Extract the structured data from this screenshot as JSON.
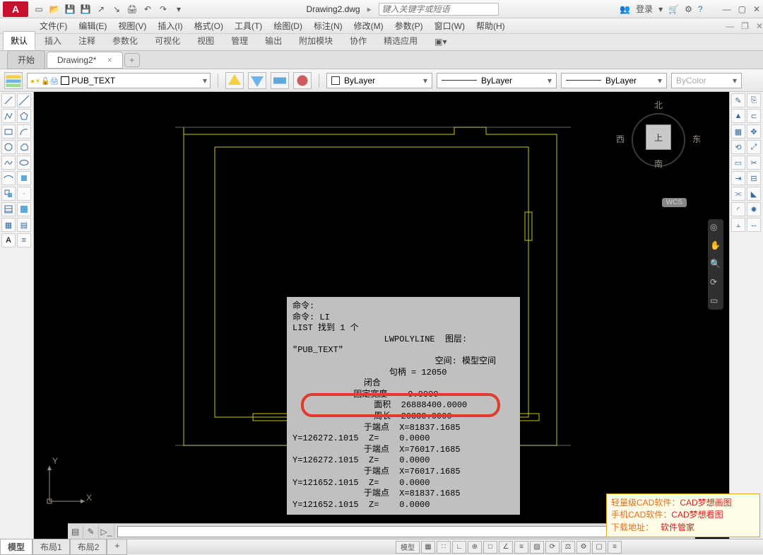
{
  "title": {
    "doc": "Drawing2.dwg",
    "search_placeholder": "键入关键字或短语",
    "login": "登录"
  },
  "menu": [
    "文件(F)",
    "编辑(E)",
    "视图(V)",
    "插入(I)",
    "格式(O)",
    "工具(T)",
    "绘图(D)",
    "标注(N)",
    "修改(M)",
    "参数(P)",
    "窗口(W)",
    "帮助(H)"
  ],
  "ribbon_tabs": [
    "默认",
    "插入",
    "注释",
    "参数化",
    "可视化",
    "视图",
    "管理",
    "输出",
    "附加模块",
    "协作",
    "精选应用"
  ],
  "file_tabs": {
    "start": "开始",
    "active": "Drawing2*"
  },
  "layer": {
    "current": "PUB_TEXT",
    "linetype_label": "ByLayer",
    "lineweight_label": "ByLayer",
    "lineweight2_label": "ByLayer",
    "color_label": "ByColor"
  },
  "viewcube": {
    "n": "北",
    "s": "南",
    "e": "东",
    "w": "西",
    "top": "上",
    "wcs": "WCS"
  },
  "cmd_output": "命令:\n命令: LI\nLIST 找到 1 个\n                  LWPOLYLINE  图层:\n\"PUB_TEXT\"\n                            空间: 模型空间\n                   句柄 = 12050\n              闭合\n            固定宽度    0.0000\n                面积  26888400.0000\n                周长  20880.0000\n              于端点  X=81837.1685\nY=126272.1015  Z=    0.0000\n              于端点  X=76017.1685\nY=126272.1015  Z=    0.0000\n              于端点  X=76017.1685\nY=121652.1015  Z=    0.0000\n              于端点  X=81837.1685\nY=121652.1015  Z=    0.0000",
  "status": {
    "model": "模型",
    "layout1": "布局1",
    "layout2": "布局2",
    "model_btn": "模型"
  },
  "promo": {
    "l1a": "轻量级CAD软件：",
    "l1b": "CAD梦想画图",
    "l2a": "手机CAD软件：",
    "l2b": "CAD梦想看图",
    "l3a": "下载地址：",
    "l3b": "软件管家"
  },
  "ucs": {
    "x": "X",
    "y": "Y"
  }
}
